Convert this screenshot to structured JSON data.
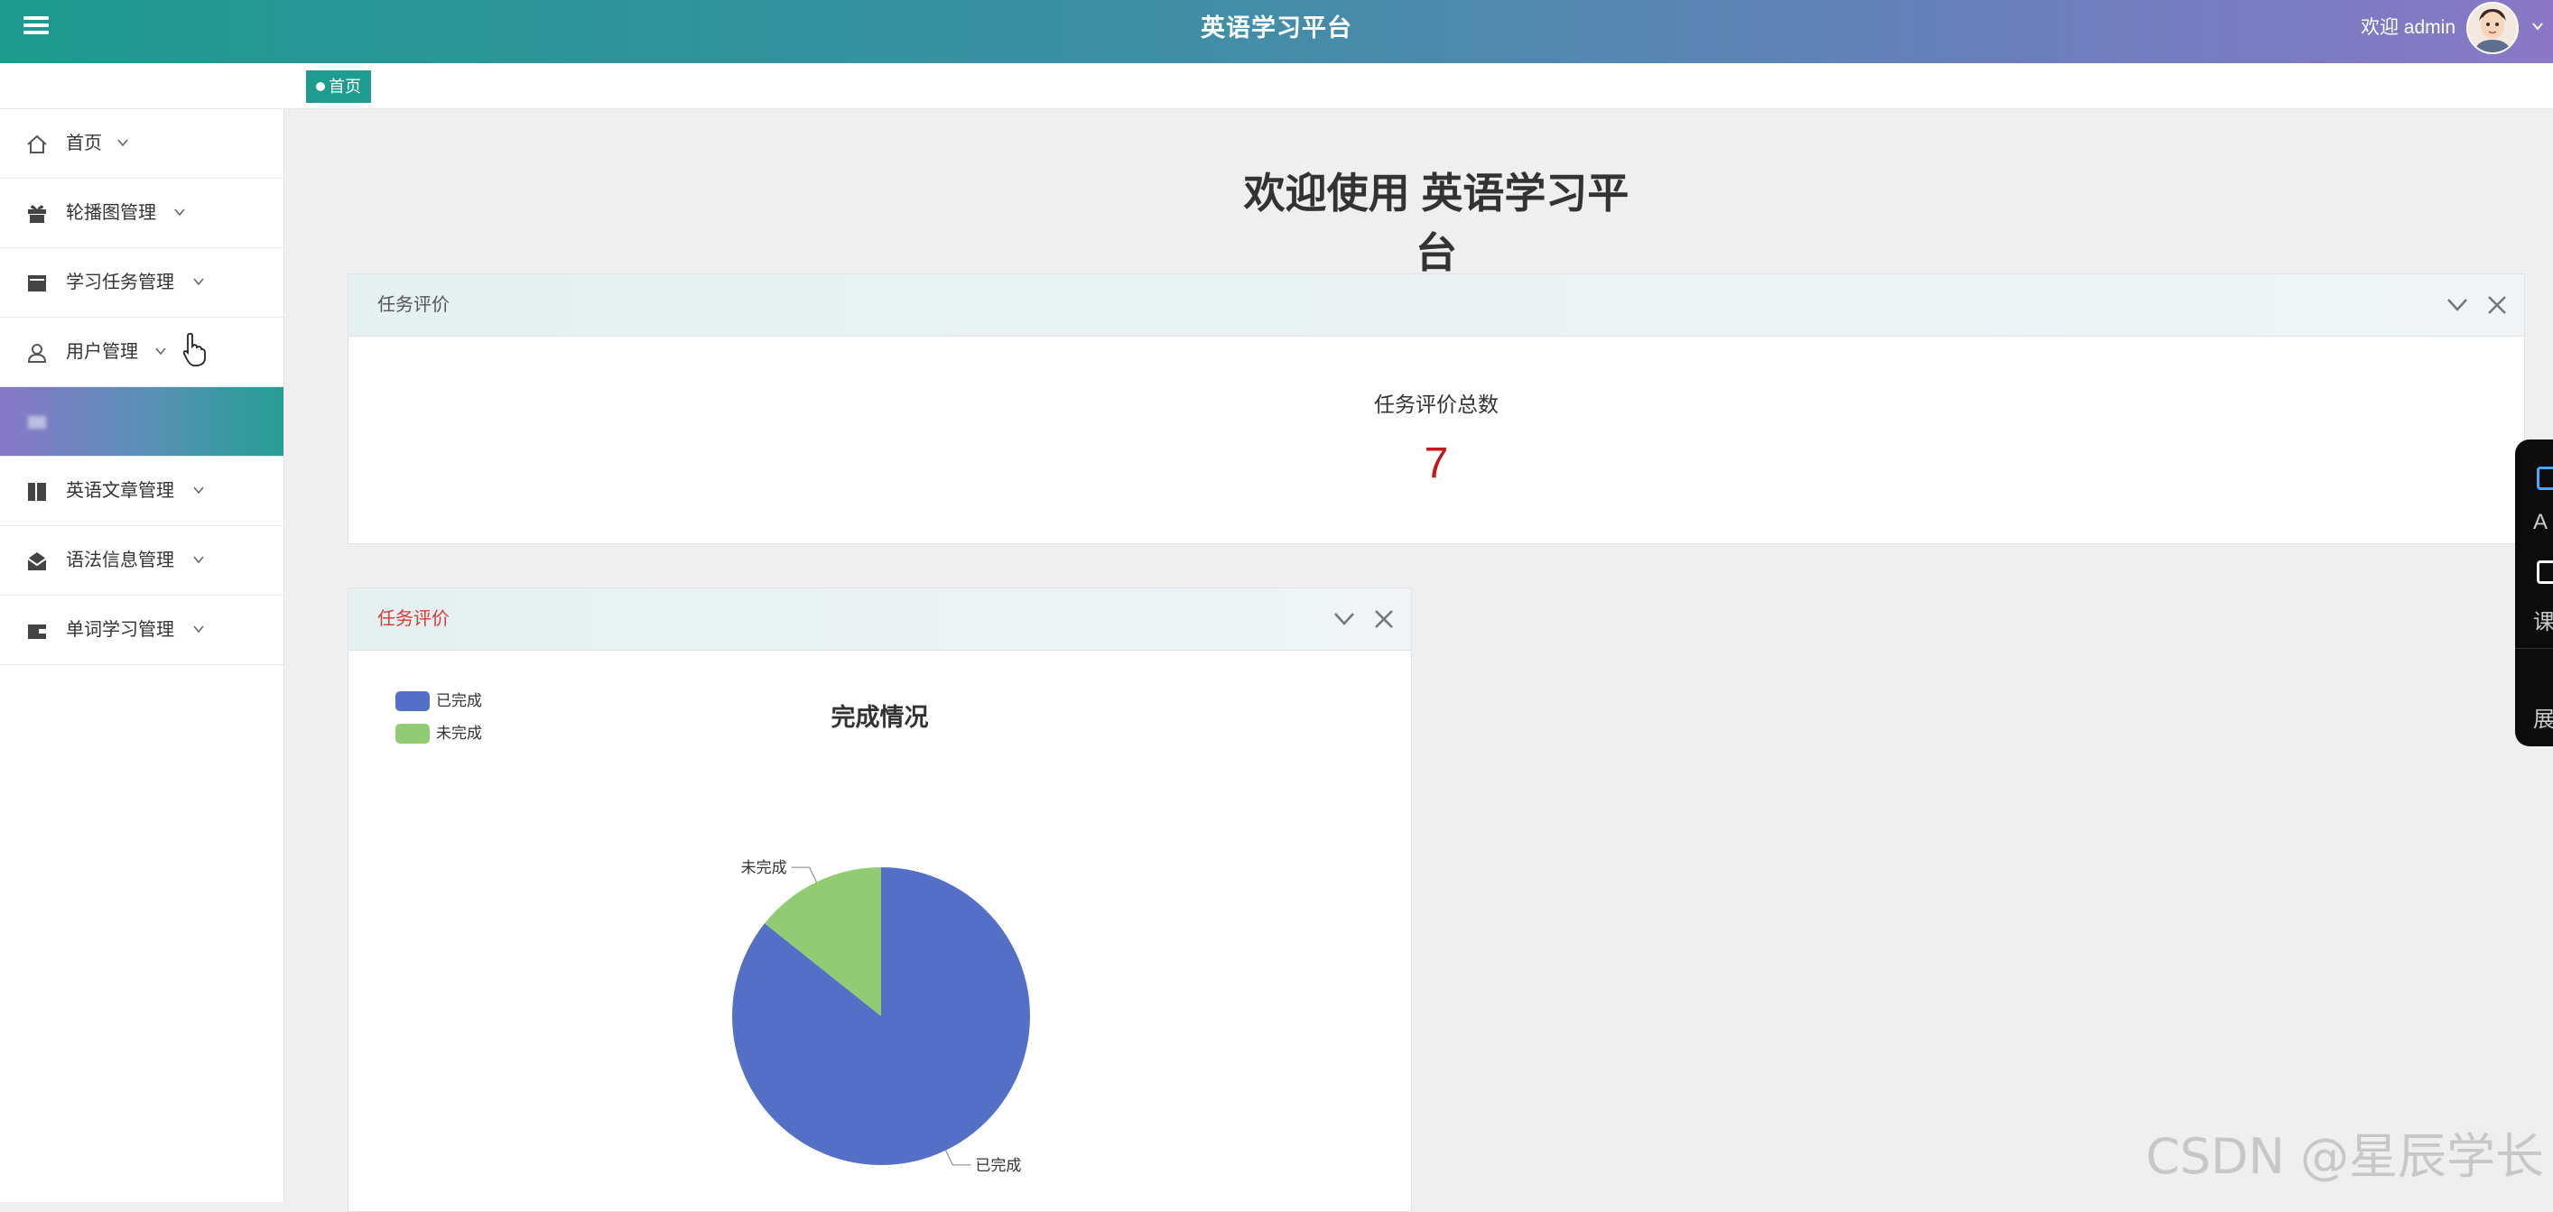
{
  "header": {
    "title": "英语学习平台",
    "welcome": "欢迎 admin"
  },
  "tagbar": {
    "tag_label": "首页"
  },
  "sidebar": {
    "items": [
      {
        "label": "首页",
        "icon": "home-icon"
      },
      {
        "label": "轮播图管理",
        "icon": "gift-icon"
      },
      {
        "label": "学习任务管理",
        "icon": "card-icon"
      },
      {
        "label": "用户管理",
        "icon": "user-icon"
      },
      {
        "label": "",
        "icon": "blurred-icon",
        "active": true
      },
      {
        "label": "英语文章管理",
        "icon": "book-icon"
      },
      {
        "label": "语法信息管理",
        "icon": "mail-icon"
      },
      {
        "label": "单词学习管理",
        "icon": "wallet-icon"
      }
    ]
  },
  "main": {
    "heading": "欢迎使用 英语学习平台",
    "stat_panel": {
      "title": "任务评价",
      "stat_label": "任务评价总数",
      "stat_value": "7"
    },
    "chart_panel": {
      "title": "任务评价"
    }
  },
  "chart_data": {
    "type": "pie",
    "title": "完成情况",
    "categories": [
      "已完成",
      "未完成"
    ],
    "values": [
      6,
      1
    ],
    "colors": [
      "#5470c6",
      "#91cc75"
    ],
    "legend_position": "top-left",
    "slice_labels": [
      "已完成",
      "未完成"
    ]
  },
  "float_widget": {
    "items": [
      "A",
      "课",
      "展"
    ]
  },
  "watermark": "CSDN @星辰学长",
  "colors": {
    "accent": "#1e9c8f",
    "stat_value": "#c0181c"
  }
}
